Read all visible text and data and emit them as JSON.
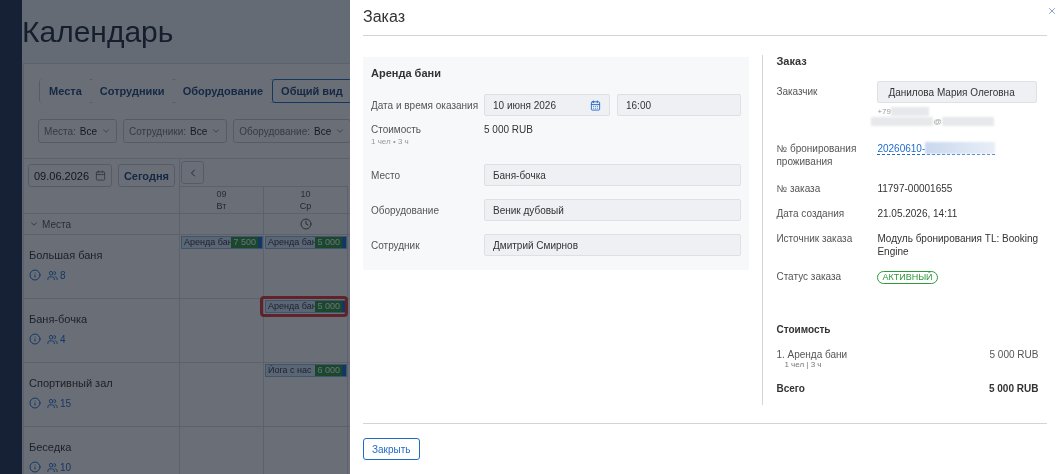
{
  "page": {
    "title": "Календарь"
  },
  "view_tabs": [
    {
      "label": "Места",
      "selected": false
    },
    {
      "label": "Сотрудники",
      "selected": false
    },
    {
      "label": "Оборудование",
      "selected": false
    },
    {
      "label": "Общий вид",
      "selected": true
    }
  ],
  "filters": [
    {
      "label": "Места:",
      "value": "Все"
    },
    {
      "label": "Сотрудники:",
      "value": "Все"
    },
    {
      "label": "Оборудование:",
      "value": "Все"
    }
  ],
  "date_field": {
    "value": "09.06.2026"
  },
  "today_button": "Сегодня",
  "columns": [
    {
      "day": "09",
      "weekday": "Вт",
      "clock_marker": false
    },
    {
      "day": "10",
      "weekday": "Ср",
      "clock_marker": true
    }
  ],
  "group": {
    "label": "Места",
    "expanded": true
  },
  "resources": [
    {
      "name": "Большая баня",
      "capacity": "8",
      "cells": [
        [
          {
            "title": "Аренда бан",
            "price": "7 500",
            "selected": false
          }
        ],
        [
          {
            "title": "Аренда бан",
            "price": "5 000",
            "selected": false
          }
        ]
      ]
    },
    {
      "name": "Баня-бочка",
      "capacity": "4",
      "cells": [
        [],
        [
          {
            "title": "Аренда бан",
            "price": "5 000",
            "selected": true
          }
        ]
      ]
    },
    {
      "name": "Спортивный зал",
      "capacity": "15",
      "cells": [
        [],
        [
          {
            "title": "Йога с нас",
            "price": "6 000",
            "selected": false
          }
        ]
      ]
    },
    {
      "name": "Беседка",
      "capacity": "10",
      "cells": [
        [],
        []
      ]
    }
  ],
  "order_modal": {
    "title": "Заказ",
    "service": {
      "title": "Аренда бани",
      "fields": [
        {
          "kind": "datetime",
          "label": "Дата и время оказания",
          "date": "10 июня 2026",
          "time": "16:00"
        },
        {
          "kind": "price",
          "label": "Стоимость",
          "note": "1 чел • 3 ч",
          "value": "5 000 RUB"
        },
        {
          "kind": "field",
          "label": "Место",
          "value": "Баня-бочка"
        },
        {
          "kind": "field",
          "label": "Оборудование",
          "value": "Веник дубовый"
        },
        {
          "kind": "field",
          "label": "Сотрудник",
          "value": "Дмитрий Смирнов"
        }
      ]
    },
    "order": {
      "title": "Заказ",
      "rows": [
        {
          "kind": "customer",
          "label": "Заказчик",
          "value": "Данилова Мария Олеговна",
          "phone": "+79",
          "email": "@"
        },
        {
          "kind": "link",
          "label": "№ бронирования проживания",
          "value": "20260610-"
        },
        {
          "kind": "text",
          "label": "№ заказа",
          "value": "11797-00001655"
        },
        {
          "kind": "text",
          "label": "Дата создания",
          "value": "21.05.2026, 14:11"
        },
        {
          "kind": "text",
          "label": "Источник заказа",
          "value": "Модуль бронирования TL: Booking Engine"
        },
        {
          "kind": "status",
          "label": "Статус заказа",
          "value": "АКТИВНЫЙ"
        }
      ]
    },
    "cost": {
      "title": "Стоимость",
      "items": [
        {
          "name": "1. Аренда бани",
          "detail": "1 чел | 3 ч",
          "price": "5 000 RUB"
        }
      ],
      "total_label": "Всего",
      "total": "5 000 RUB"
    },
    "close_button": "Закрыть"
  }
}
